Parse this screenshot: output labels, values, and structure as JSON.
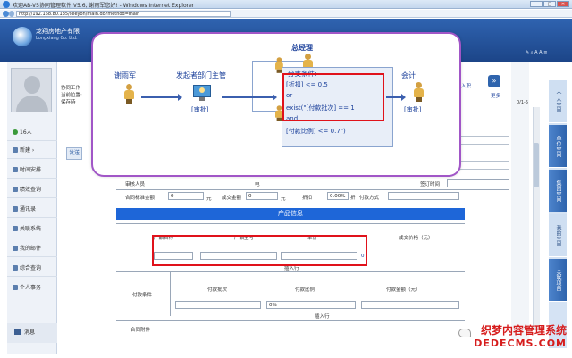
{
  "browser": {
    "title": "欢迎AB-V5协同管理软件 V5.6, 谢雨军您好! - Windows Internet Explorer",
    "url": "http://192.168.80.135/seeyon/main.do?method=main",
    "window_buttons": [
      "—",
      "□",
      "✕"
    ]
  },
  "app": {
    "brand": "龙翔房地产有限",
    "brand_sub": "Longxiang Co. Ltd.",
    "header_buttons": [
      "入职",
      "更多"
    ],
    "header_tools": "✎  ⌕  A A  ≡"
  },
  "sidebar": {
    "status": "16人",
    "items": [
      "新建 ›",
      "时间安排",
      "绩效查询",
      "通讯录",
      "关联系统",
      "我的邮件",
      "综合查询",
      "个人事务"
    ],
    "message": "消息"
  },
  "toolbar": {
    "collab_label": "协同工作",
    "current_pos": "当前位置:",
    "save_draft": "保存待",
    "send": "发送"
  },
  "right_tabs": [
    "个人空间",
    "单位空间",
    "集团空间",
    "我的空间",
    "关联项目"
  ],
  "right_small": "0/1-5",
  "form": {
    "row1": {
      "reviewer": "审核人员",
      "phone": "电",
      "plan_date": "签订时间"
    },
    "row2": {
      "contract_amount_label": "合同标准金额",
      "contract_amount": "0",
      "unit1": "元",
      "deal_amount_label": "成交金额",
      "deal_amount": "0",
      "unit2": "元",
      "discount_label": "折扣",
      "discount": "0.00%",
      "discount_unit": "折",
      "payment_method_label": "付款方式"
    },
    "product_section": "产品信息",
    "product_headers": [
      "产品名称",
      "产品型号",
      "单价",
      "成交价格（元）"
    ],
    "product_total": "0",
    "insert_row_1": "插入行",
    "payment_label": "付款条件",
    "payment_headers": [
      "付款批次",
      "付款比例",
      "付款金额（元）"
    ],
    "payment_ratio": "0%",
    "insert_row_2": "插入行",
    "attachment_label": "合同附件"
  },
  "workflow": {
    "nodes": [
      {
        "name": "谢雨军"
      },
      {
        "name": "发起者部门主管",
        "tag": "[审批]"
      },
      {
        "name": "总经理"
      },
      {
        "name": "会计",
        "tag": "[审批]"
      }
    ],
    "condition_title": "分支条件:",
    "condition_lines": [
      "[折扣] <= 0.5",
      "or",
      "exist(\"[付款批次] == 1",
      "and",
      "[付款比例] <= 0.7\")"
    ]
  },
  "watermark": {
    "line1": "织梦内容管理系统",
    "line2": "DEDECMS.COM"
  },
  "colors": {
    "popup_border": "#a156c7",
    "highlight": "#e0121b",
    "section_blue": "#1e66d8"
  }
}
